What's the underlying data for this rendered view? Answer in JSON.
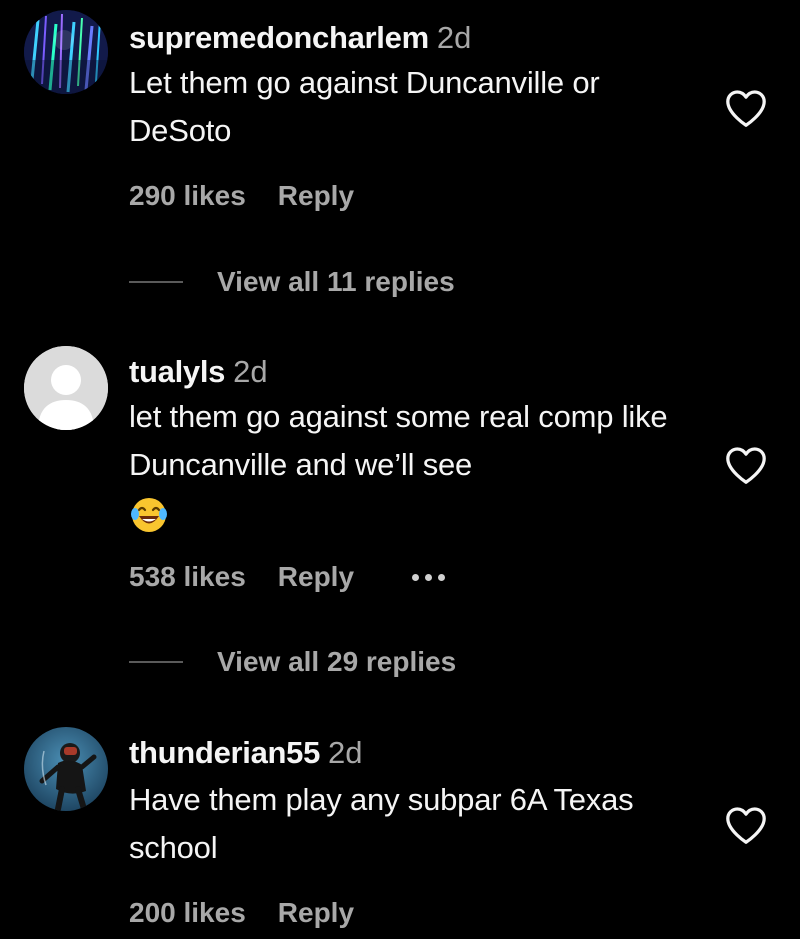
{
  "comments": [
    {
      "username": "supremedoncharlem",
      "time": "2d",
      "text": "Let them go against Duncanville or DeSoto",
      "likes": "290 likes",
      "reply_label": "Reply",
      "view_replies": "View all 11 replies",
      "avatar": "colorful-abstract-avatar",
      "like_icon": "heart-outline-icon"
    },
    {
      "username": "tualyls",
      "time": "2d",
      "text": "let them go against some real comp like Duncanville and we’ll see",
      "emoji": "😂",
      "likes": "538 likes",
      "reply_label": "Reply",
      "more_icon": "ellipsis-icon",
      "view_replies": "View all 29 replies",
      "avatar": "default-gray-avatar",
      "like_icon": "heart-outline-icon"
    },
    {
      "username": "thunderian55",
      "time": "2d",
      "text": "Have them play any subpar 6A Texas school",
      "likes": "200 likes",
      "reply_label": "Reply",
      "avatar": "scuba-diver-avatar",
      "like_icon": "heart-outline-icon"
    }
  ],
  "colors": {
    "background": "#000000",
    "primary_text": "#f5f5f5",
    "secondary_text": "#a8a8a8"
  }
}
